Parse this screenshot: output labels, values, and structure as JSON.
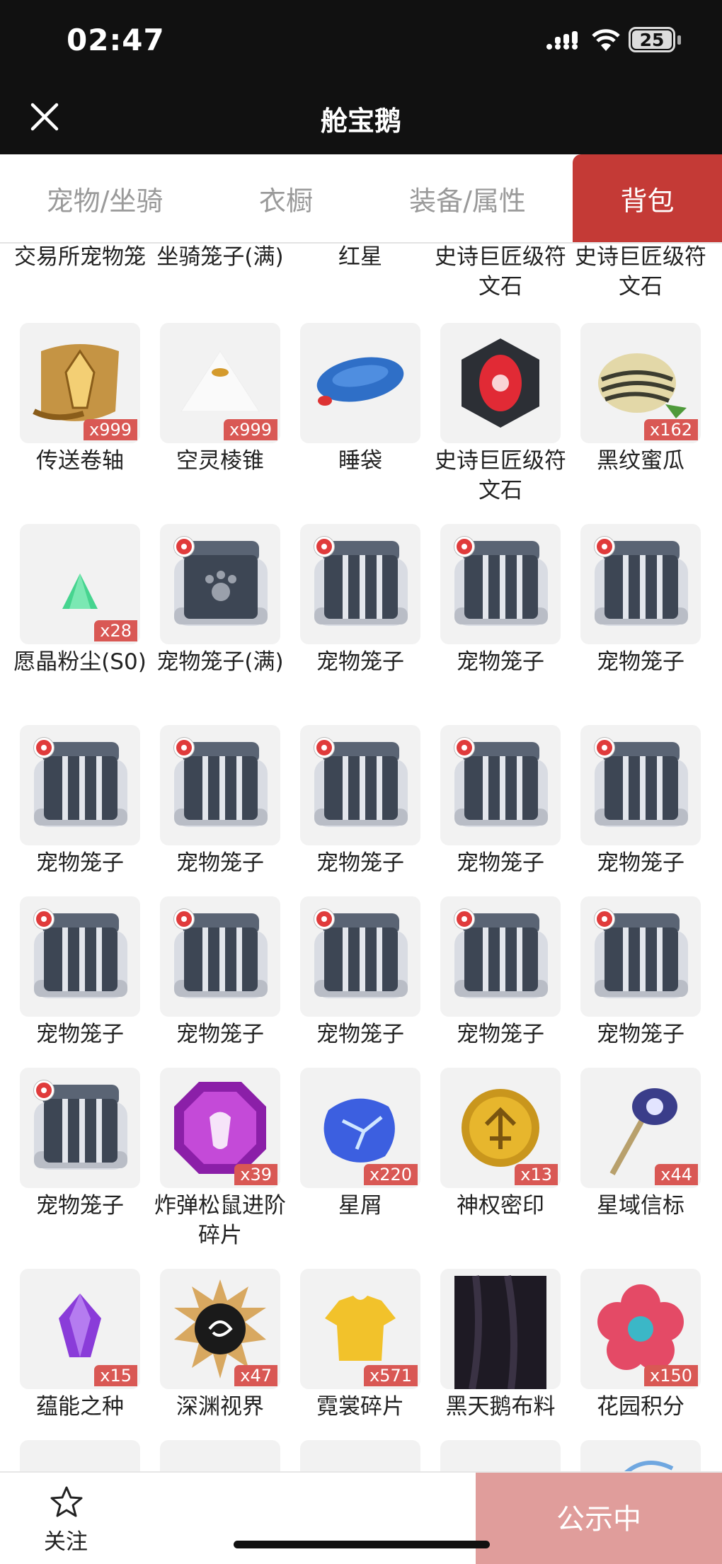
{
  "status_bar": {
    "time": "02:47",
    "battery": "25"
  },
  "header": {
    "title": "舱宝鹅"
  },
  "tabs": [
    {
      "label": "宠物/坐骑",
      "active": false
    },
    {
      "label": "衣橱",
      "active": false
    },
    {
      "label": "装备/属性",
      "active": false
    },
    {
      "label": "背包",
      "active": true
    }
  ],
  "colors": {
    "accent": "#c43a36",
    "quantity_badge": "#d95854",
    "publish_button": "#e09d9b"
  },
  "items": [
    {
      "name": "交易所宠物笼",
      "qty": "",
      "icon": "pet-cage-icon"
    },
    {
      "name": "坐骑笼子(满)",
      "qty": "",
      "icon": "mount-cage-icon"
    },
    {
      "name": "红星",
      "qty": "",
      "icon": "red-star-icon"
    },
    {
      "name": "史诗巨匠级符文石",
      "qty": "",
      "icon": "rune-stone-icon"
    },
    {
      "name": "史诗巨匠级符文石",
      "qty": "",
      "icon": "rune-stone-icon"
    },
    {
      "name": "传送卷轴",
      "qty": "x999",
      "icon": "teleport-scroll-icon"
    },
    {
      "name": "空灵棱锥",
      "qty": "x999",
      "icon": "pyramid-icon"
    },
    {
      "name": "睡袋",
      "qty": "",
      "icon": "sleeping-bag-icon"
    },
    {
      "name": "史诗巨匠级符文石",
      "qty": "",
      "icon": "rune-stone-icon"
    },
    {
      "name": "黑纹蜜瓜",
      "qty": "x162",
      "icon": "melon-icon"
    },
    {
      "name": "愿晶粉尘(S0)",
      "qty": "x28",
      "icon": "crystal-dust-icon"
    },
    {
      "name": "宠物笼子(满)",
      "qty": "",
      "icon": "pet-cage-full-icon"
    },
    {
      "name": "宠物笼子",
      "qty": "",
      "icon": "pet-cage-icon"
    },
    {
      "name": "宠物笼子",
      "qty": "",
      "icon": "pet-cage-icon"
    },
    {
      "name": "宠物笼子",
      "qty": "",
      "icon": "pet-cage-icon"
    },
    {
      "name": "宠物笼子",
      "qty": "",
      "icon": "pet-cage-icon"
    },
    {
      "name": "宠物笼子",
      "qty": "",
      "icon": "pet-cage-icon"
    },
    {
      "name": "宠物笼子",
      "qty": "",
      "icon": "pet-cage-icon"
    },
    {
      "name": "宠物笼子",
      "qty": "",
      "icon": "pet-cage-icon"
    },
    {
      "name": "宠物笼子",
      "qty": "",
      "icon": "pet-cage-icon"
    },
    {
      "name": "宠物笼子",
      "qty": "",
      "icon": "pet-cage-icon"
    },
    {
      "name": "宠物笼子",
      "qty": "",
      "icon": "pet-cage-icon"
    },
    {
      "name": "宠物笼子",
      "qty": "",
      "icon": "pet-cage-icon"
    },
    {
      "name": "宠物笼子",
      "qty": "",
      "icon": "pet-cage-icon"
    },
    {
      "name": "宠物笼子",
      "qty": "",
      "icon": "pet-cage-icon"
    },
    {
      "name": "宠物笼子",
      "qty": "",
      "icon": "pet-cage-icon"
    },
    {
      "name": "炸弹松鼠进阶碎片",
      "qty": "x39",
      "icon": "purple-gem-icon"
    },
    {
      "name": "星屑",
      "qty": "x220",
      "icon": "star-shard-icon"
    },
    {
      "name": "神权密印",
      "qty": "x13",
      "icon": "gold-seal-icon"
    },
    {
      "name": "星域信标",
      "qty": "x44",
      "icon": "beacon-icon"
    },
    {
      "name": "蕴能之种",
      "qty": "x15",
      "icon": "energy-crystal-icon"
    },
    {
      "name": "深渊视界",
      "qty": "x47",
      "icon": "abyss-eye-icon"
    },
    {
      "name": "霓裳碎片",
      "qty": "x571",
      "icon": "shirt-shard-icon"
    },
    {
      "name": "黑天鹅布料",
      "qty": "",
      "icon": "black-cloth-icon"
    },
    {
      "name": "花园积分",
      "qty": "x150",
      "icon": "flower-badge-icon"
    },
    {
      "name": "",
      "qty": "",
      "icon": "gold-coin-icon"
    },
    {
      "name": "",
      "qty": "",
      "icon": "gold-coin-icon"
    },
    {
      "name": "",
      "qty": "",
      "icon": "gold-coin-icon"
    },
    {
      "name": "",
      "qty": "",
      "icon": "gold-coin-icon"
    },
    {
      "name": "",
      "qty": "",
      "icon": "wing-icon"
    }
  ],
  "bottom_bar": {
    "follow_label": "关注",
    "publish_label": "公示中"
  }
}
